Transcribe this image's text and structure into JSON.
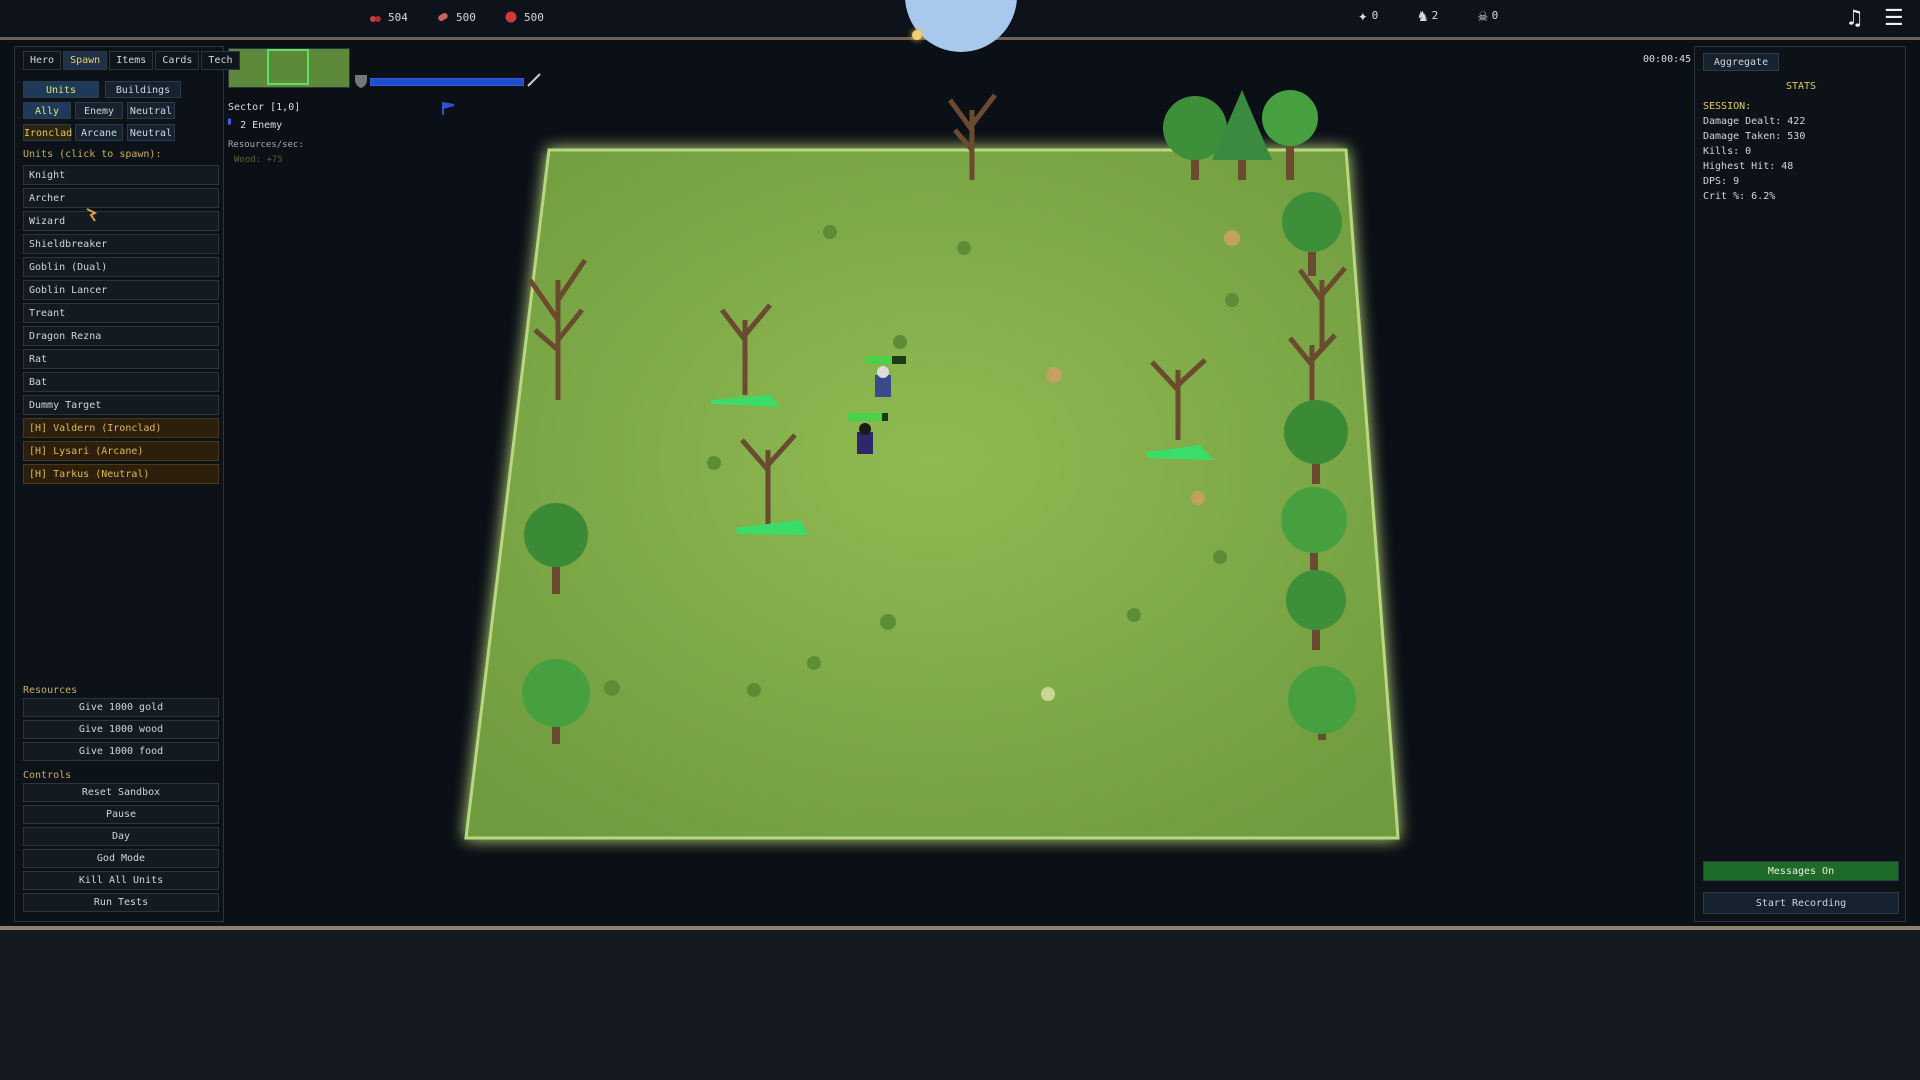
{
  "topbar": {
    "resources": [
      {
        "icon": "berries-icon",
        "value": "504"
      },
      {
        "icon": "meat-icon",
        "value": "500"
      },
      {
        "icon": "stone-icon",
        "value": "500"
      }
    ],
    "population": [
      {
        "icon": "wizard-unit-icon",
        "value": "0"
      },
      {
        "icon": "knight-unit-icon",
        "value": "2"
      },
      {
        "icon": "goblin-unit-icon",
        "value": "0"
      }
    ]
  },
  "left": {
    "tabs": [
      "Hero",
      "Spawn",
      "Items",
      "Cards",
      "Tech"
    ],
    "subtabs": [
      "Units",
      "Buildings"
    ],
    "factions": [
      "Ally",
      "Enemy",
      "Neutral"
    ],
    "alignments": [
      "Ironclad",
      "Arcane",
      "Neutral"
    ],
    "units_label": "Units (click to spawn):",
    "units": [
      "Knight",
      "Archer",
      "Wizard",
      "Shieldbreaker",
      "Goblin (Dual)",
      "Goblin Lancer",
      "Treant",
      "Dragon Rezna",
      "Rat",
      "Bat",
      "Dummy Target"
    ],
    "heroes": [
      "[H] Valdern (Ironclad)",
      "[H] Lysari (Arcane)",
      "[H] Tarkus (Neutral)"
    ],
    "resources_label": "Resources",
    "resource_actions": [
      "Give 1000 gold",
      "Give 1000 wood",
      "Give 1000 food"
    ],
    "controls_label": "Controls",
    "controls": [
      "Reset Sandbox",
      "Pause",
      "Day",
      "God Mode",
      "Kill All Units",
      "Run Tests"
    ]
  },
  "hud": {
    "sector": "Sector [1,0]",
    "enemies": "2 Enemy",
    "resources_sec": "Resources/sec:",
    "wood_rate": "Wood: +75",
    "timer": "00:00:45"
  },
  "right": {
    "aggregate": "Aggregate",
    "stats_title": "STATS",
    "session_label": "SESSION:",
    "stats": [
      "Damage Dealt: 422",
      "Damage Taken: 530",
      "Kills: 0",
      "Highest Hit: 48",
      "DPS: 9",
      "Crit %: 6.2%"
    ],
    "messages_button": "Messages On",
    "record_button": "Start Recording"
  }
}
